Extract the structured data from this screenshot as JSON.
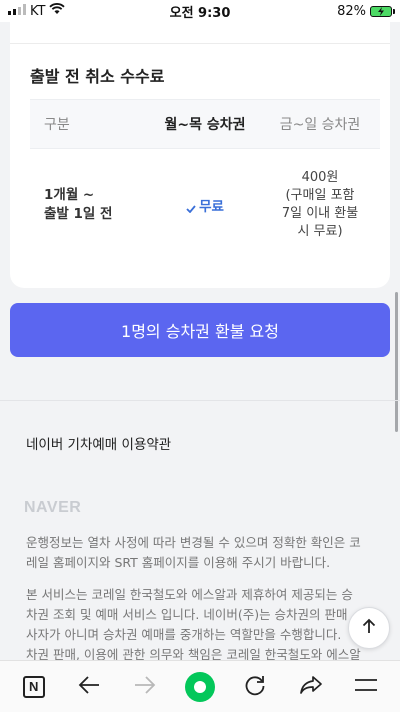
{
  "status_bar": {
    "carrier": "KT",
    "time": "오전 9:30",
    "battery_percent": "82%"
  },
  "fee_section": {
    "title": "출발 전 취소 수수료",
    "headers": [
      "구분",
      "월~목 승차권",
      "금~일 승차권"
    ],
    "rows": [
      {
        "period_line1": "1개월 ~",
        "period_line2": "출발 1일 전",
        "weekday_fee": "무료",
        "weekend_fee_lines": [
          "400원",
          "(구매일 포함",
          "7일 이내 환불",
          "시 무료)"
        ]
      }
    ]
  },
  "refund_button": {
    "label": "1명의 승차권 환불 요청"
  },
  "terms": {
    "label": "네이버 기차예매 이용약관"
  },
  "footer": {
    "logo": "NAVER",
    "paragraph1_lines": [
      "운행정보는 열차 사정에 따라 변경될 수 있으며 정확한 확인은 코",
      "레일 홈페이지와 SRT 홈페이지를 이용해 주시기 바랍니다."
    ],
    "paragraph2_lines": [
      "본 서비스는 코레일 한국철도와 에스알과 제휴하여 제공되는 승",
      "차권 조회 및 예매 서비스 입니다. 네이버(주)는 승차권의 판매",
      "사자가 아니며 승차권 예매를 중개하는 역할만을 수행합니다.",
      "차권 판매, 이용에 관한 의무와 책임은 코레일 한국철도와 에스알"
    ]
  },
  "colors": {
    "accent": "#5b66f0",
    "free_text": "#3a6fd8",
    "naver_green": "#03c75a"
  },
  "toolbar": {
    "naver_label": "N",
    "icons": [
      "naver-n-icon",
      "back-arrow-icon",
      "forward-arrow-icon",
      "green-dot-icon",
      "reload-icon",
      "share-icon",
      "menu-icon"
    ]
  }
}
